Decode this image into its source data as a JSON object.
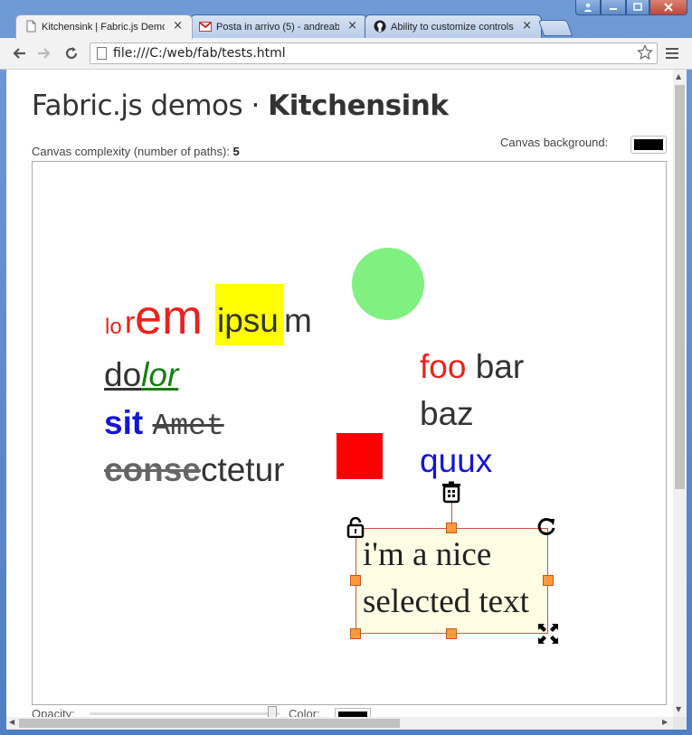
{
  "browser": {
    "tabs": [
      {
        "label": "Kitchensink | Fabric.js Demos",
        "icon": "page-icon",
        "active": true
      },
      {
        "label": "Posta in arrivo (5) - andreab",
        "icon": "gmail-icon",
        "active": false
      },
      {
        "label": "Ability to customize controls",
        "icon": "github-icon",
        "active": false
      }
    ],
    "tab_close": "×",
    "address": "file:///C:/web/fab/tests.html",
    "window_controls": [
      "user-icon",
      "minimize-icon",
      "maximize-icon",
      "close-icon"
    ]
  },
  "page": {
    "title_light": "Fabric.js demos · ",
    "title_bold": "Kitchensink",
    "complexity_label": "Canvas complexity (number of paths): ",
    "complexity_value": "5",
    "background_label": "Canvas background:",
    "background_color": "#000000",
    "opacity_label": "Opacity:",
    "color_label": "Color:",
    "color_value": "#000000"
  },
  "canvas": {
    "text_lorem": {
      "p1": "lo",
      "p2": "r",
      "p3": "em",
      "p4": " ",
      "p5": "ipsu",
      "p6": "m"
    },
    "text_dolor": {
      "p1": "do",
      "p2": "lor"
    },
    "text_sit": {
      "p1": "sit",
      "p2": " ",
      "p3": "Amet"
    },
    "text_conse": {
      "p1": "conse",
      "p2": "ctetur"
    },
    "text_foo": {
      "line1a": "foo",
      "line1b": " bar",
      "line2": "baz",
      "line3": "quux"
    },
    "selected_text": {
      "line1": "i'm a nice",
      "line2": "selected text"
    },
    "colors": {
      "circle": "#80f080",
      "square": "#ff0000",
      "highlight": "#ffff00",
      "selection_bg": "#fffde4",
      "handle": "#ff9a3c",
      "selection_border": "#d05050"
    }
  }
}
